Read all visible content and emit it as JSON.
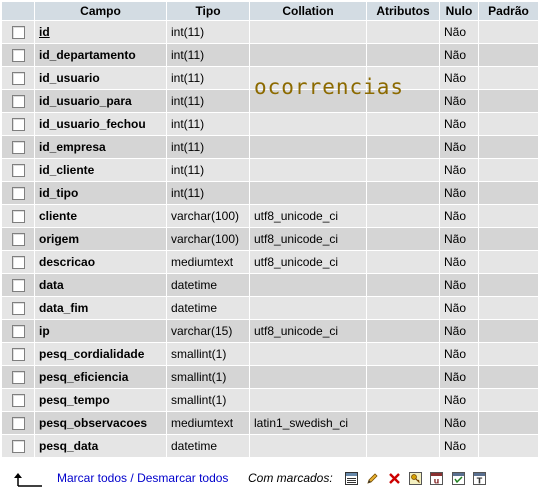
{
  "table": {
    "headers": [
      "Campo",
      "Tipo",
      "Collation",
      "Atributos",
      "Nulo",
      "Padrão"
    ],
    "rows": [
      {
        "campo": "id",
        "tipo": "int(11)",
        "collation": "",
        "atributos": "",
        "nulo": "Não",
        "padrao": "",
        "primary": true
      },
      {
        "campo": "id_departamento",
        "tipo": "int(11)",
        "collation": "",
        "atributos": "",
        "nulo": "Não",
        "padrao": ""
      },
      {
        "campo": "id_usuario",
        "tipo": "int(11)",
        "collation": "",
        "atributos": "",
        "nulo": "Não",
        "padrao": ""
      },
      {
        "campo": "id_usuario_para",
        "tipo": "int(11)",
        "collation": "",
        "atributos": "",
        "nulo": "Não",
        "padrao": ""
      },
      {
        "campo": "id_usuario_fechou",
        "tipo": "int(11)",
        "collation": "",
        "atributos": "",
        "nulo": "Não",
        "padrao": ""
      },
      {
        "campo": "id_empresa",
        "tipo": "int(11)",
        "collation": "",
        "atributos": "",
        "nulo": "Não",
        "padrao": ""
      },
      {
        "campo": "id_cliente",
        "tipo": "int(11)",
        "collation": "",
        "atributos": "",
        "nulo": "Não",
        "padrao": ""
      },
      {
        "campo": "id_tipo",
        "tipo": "int(11)",
        "collation": "",
        "atributos": "",
        "nulo": "Não",
        "padrao": ""
      },
      {
        "campo": "cliente",
        "tipo": "varchar(100)",
        "collation": "utf8_unicode_ci",
        "atributos": "",
        "nulo": "Não",
        "padrao": ""
      },
      {
        "campo": "origem",
        "tipo": "varchar(100)",
        "collation": "utf8_unicode_ci",
        "atributos": "",
        "nulo": "Não",
        "padrao": ""
      },
      {
        "campo": "descricao",
        "tipo": "mediumtext",
        "collation": "utf8_unicode_ci",
        "atributos": "",
        "nulo": "Não",
        "padrao": ""
      },
      {
        "campo": "data",
        "tipo": "datetime",
        "collation": "",
        "atributos": "",
        "nulo": "Não",
        "padrao": ""
      },
      {
        "campo": "data_fim",
        "tipo": "datetime",
        "collation": "",
        "atributos": "",
        "nulo": "Não",
        "padrao": ""
      },
      {
        "campo": "ip",
        "tipo": "varchar(15)",
        "collation": "utf8_unicode_ci",
        "atributos": "",
        "nulo": "Não",
        "padrao": ""
      },
      {
        "campo": "pesq_cordialidade",
        "tipo": "smallint(1)",
        "collation": "",
        "atributos": "",
        "nulo": "Não",
        "padrao": ""
      },
      {
        "campo": "pesq_eficiencia",
        "tipo": "smallint(1)",
        "collation": "",
        "atributos": "",
        "nulo": "Não",
        "padrao": ""
      },
      {
        "campo": "pesq_tempo",
        "tipo": "smallint(1)",
        "collation": "",
        "atributos": "",
        "nulo": "Não",
        "padrao": ""
      },
      {
        "campo": "pesq_observacoes",
        "tipo": "mediumtext",
        "collation": "latin1_swedish_ci",
        "atributos": "",
        "nulo": "Não",
        "padrao": ""
      },
      {
        "campo": "pesq_data",
        "tipo": "datetime",
        "collation": "",
        "atributos": "",
        "nulo": "Não",
        "padrao": ""
      }
    ]
  },
  "overlay_text": "ocorrencias",
  "footer": {
    "check_all": "Marcar todos",
    "separator": "/",
    "uncheck_all": "Desmarcar todos",
    "with_selected": "Com marcados:",
    "action_icons": [
      "browse-icon",
      "edit-icon",
      "delete-icon",
      "primary-key-icon",
      "unique-icon",
      "index-icon",
      "fulltext-icon"
    ]
  },
  "colors": {
    "header_bg": "#d3dce3",
    "row_odd": "#e5e5e5",
    "row_even": "#d5d5d5",
    "link": "#0000cc",
    "watermark": "#8c6a00"
  }
}
